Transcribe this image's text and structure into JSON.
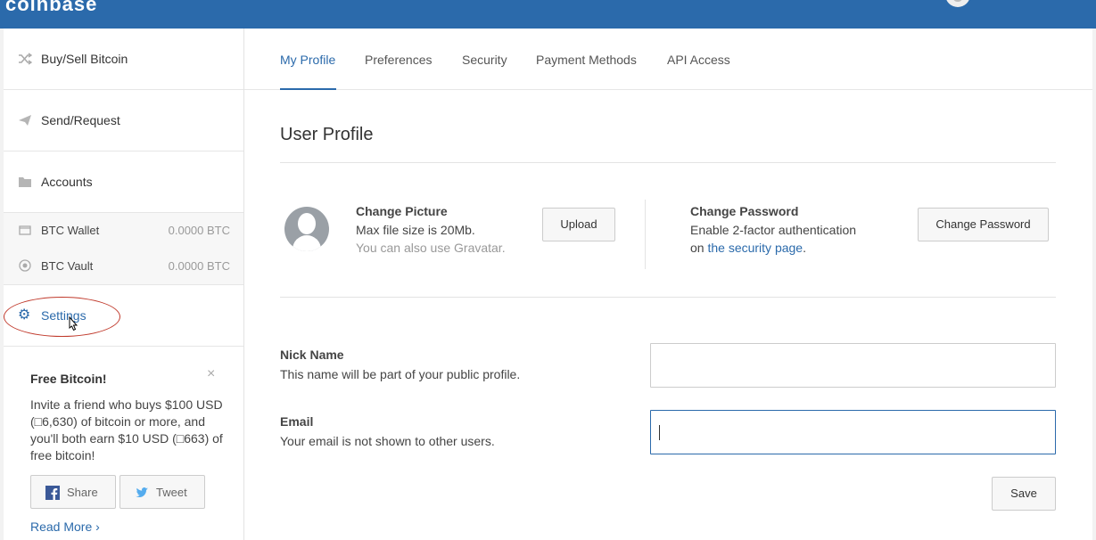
{
  "header": {
    "brand": "coinbase"
  },
  "sidebar": {
    "items": [
      {
        "label": "Buy/Sell Bitcoin",
        "icon": "shuffle-icon"
      },
      {
        "label": "Send/Request",
        "icon": "paper-plane-icon"
      },
      {
        "label": "Accounts",
        "icon": "folder-icon"
      }
    ],
    "accounts": [
      {
        "label": "BTC Wallet",
        "amount": "0.0000 BTC",
        "icon": "wallet-icon"
      },
      {
        "label": "BTC Vault",
        "amount": "0.0000 BTC",
        "icon": "vault-icon"
      }
    ],
    "settings": {
      "label": "Settings",
      "icon": "gear-icon"
    }
  },
  "promo": {
    "title": "Free Bitcoin!",
    "close": "×",
    "text": "Invite a friend who buys $100 USD (□6,630) of bitcoin or more, and you'll both earn $10 USD (□663) of free bitcoin!",
    "share_label": "Share",
    "tweet_label": "Tweet",
    "read_more": "Read More ›"
  },
  "tabs": [
    {
      "label": "My Profile",
      "active": true
    },
    {
      "label": "Preferences",
      "active": false
    },
    {
      "label": "Security",
      "active": false
    },
    {
      "label": "Payment Methods",
      "active": false
    },
    {
      "label": "API Access",
      "active": false
    }
  ],
  "profile": {
    "title": "User Profile",
    "change_picture": {
      "title": "Change Picture",
      "line1": "Max file size is 20Mb.",
      "line2": "You can also use Gravatar.",
      "button": "Upload"
    },
    "change_password": {
      "title": "Change Password",
      "line1": "Enable 2-factor authentication",
      "line2_prefix": "on ",
      "line2_link": "the security page",
      "line2_suffix": ".",
      "button": "Change Password"
    },
    "nick_name": {
      "label": "Nick Name",
      "help": "This name will be part of your public profile.",
      "value": ""
    },
    "email": {
      "label": "Email",
      "help": "Your email is not shown to other users.",
      "value": ""
    },
    "save_label": "Save"
  },
  "colors": {
    "header_blue": "#2b6aab",
    "accent": "#2b6aab",
    "highlight_ring": "#c0392b"
  }
}
